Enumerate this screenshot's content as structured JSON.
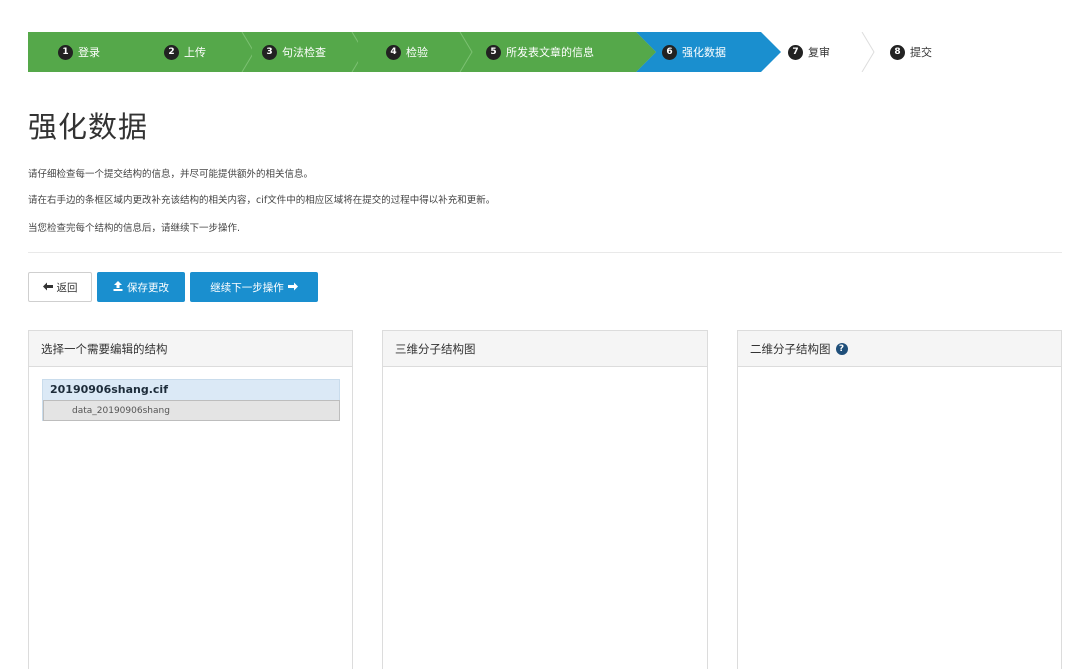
{
  "stepper": {
    "steps": [
      {
        "num": "1",
        "label": "登录",
        "state": "done"
      },
      {
        "num": "2",
        "label": "上传",
        "state": "done"
      },
      {
        "num": "3",
        "label": "句法检查",
        "state": "done"
      },
      {
        "num": "4",
        "label": "检验",
        "state": "done"
      },
      {
        "num": "5",
        "label": "所发表文章的信息",
        "state": "done"
      },
      {
        "num": "6",
        "label": "强化数据",
        "state": "active"
      },
      {
        "num": "7",
        "label": "复审",
        "state": "todo"
      },
      {
        "num": "8",
        "label": "提交",
        "state": "todo"
      }
    ],
    "colors": {
      "done": "#55a84a",
      "active": "#1a8fcf"
    }
  },
  "page": {
    "title": "强化数据",
    "desc_1": "请仔细检查每一个提交结构的信息，并尽可能提供额外的相关信息。",
    "desc_2": "请在右手边的条框区域内更改补充该结构的相关内容，cif文件中的相应区域将在提交的过程中得以补充和更新。",
    "desc_3": "当您检查完每个结构的信息后，请继续下一步操作."
  },
  "toolbar": {
    "back_label": "返回",
    "save_label": "保存更改",
    "next_label": "继续下一步操作"
  },
  "panels": {
    "select_title": "选择一个需要编辑的结构",
    "view3d_title": "三维分子结构图",
    "view2d_title": "二维分子结构图",
    "file": {
      "name": "20190906shang.cif",
      "block": "data_20190906shang"
    }
  }
}
